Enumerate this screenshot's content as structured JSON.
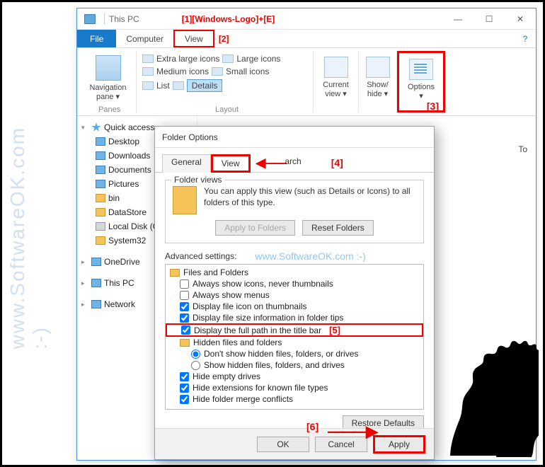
{
  "watermark": "www.SoftwareOK.com :-)",
  "explorer": {
    "title": "This PC",
    "annot1": "[1][Windows-Logo]+[E]",
    "winbtns": {
      "min": "—",
      "max": "☐",
      "close": "✕"
    },
    "menu": {
      "file": "File",
      "computer": "Computer",
      "view": "View",
      "annot2": "[2]",
      "help": "?"
    },
    "ribbon": {
      "nav": "Navigation pane ▾",
      "panes": "Panes",
      "layout": "Layout",
      "xl": "Extra large icons",
      "lg": "Large icons",
      "md": "Medium icons",
      "sm": "Small icons",
      "list": "List",
      "details": "Details",
      "current": "Current view ▾",
      "show": "Show/ hide ▾",
      "options": "Options ▾",
      "annot3": "[3]"
    },
    "tree": {
      "quick": "Quick access",
      "desktop": "Desktop",
      "downloads": "Downloads",
      "documents": "Documents",
      "pictures": "Pictures",
      "bin": "bin",
      "datastore": "DataStore",
      "localdisk": "Local Disk (C:)",
      "system32": "System32",
      "onedrive": "OneDrive",
      "thispc": "This PC",
      "network": "Network"
    },
    "main": {
      "to": "To"
    }
  },
  "dialog": {
    "title": "Folder Options",
    "tabs": {
      "general": "General",
      "view": "View",
      "search": "arch",
      "annot4": "[4]"
    },
    "fv": {
      "legend": "Folder views",
      "text": "You can apply this view (such as Details or Icons) to all folders of this type.",
      "apply": "Apply to Folders",
      "reset": "Reset Folders"
    },
    "adv": {
      "label": "Advanced settings:",
      "wm": "www.SoftwareOK.com :-)",
      "root": "Files and Folders",
      "i1": "Always show icons, never thumbnails",
      "i2": "Always show menus",
      "i3": "Display file icon on thumbnails",
      "i4": "Display file size information in folder tips",
      "i5": "Display the full path in the title bar",
      "annot5": "[5]",
      "hidden": "Hidden files and folders",
      "r1": "Don't show hidden files, folders, or drives",
      "r2": "Show hidden files, folders, and drives",
      "i6": "Hide empty drives",
      "i7": "Hide extensions for known file types",
      "i8": "Hide folder merge conflicts"
    },
    "restore": "Restore Defaults",
    "ok": "OK",
    "cancel": "Cancel",
    "apply": "Apply",
    "annot6": "[6]"
  }
}
